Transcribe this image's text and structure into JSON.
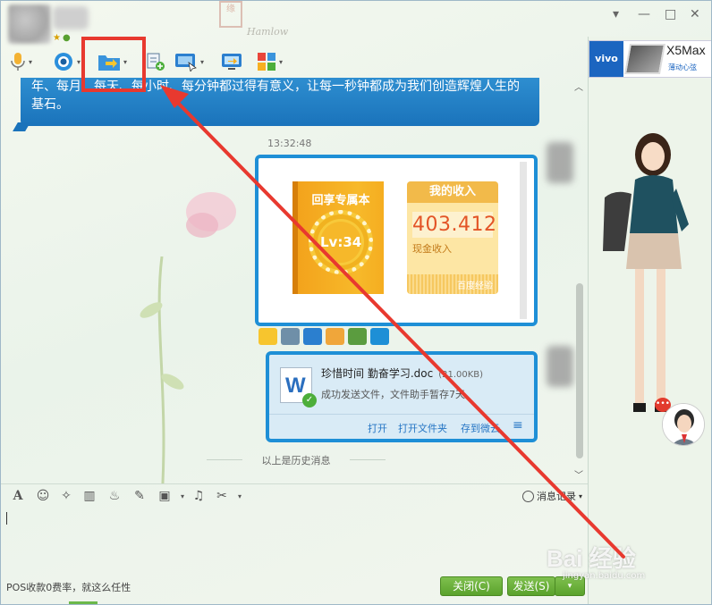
{
  "titlebar": {
    "seal_text": "缘",
    "signature_text": "Hamlow",
    "controls": {
      "menu": "▾",
      "minimize": "—",
      "maximize": "□",
      "close": "✕"
    }
  },
  "toolbar": {
    "items": [
      {
        "name": "microphone-icon"
      },
      {
        "name": "camera-icon"
      },
      {
        "name": "send-file-icon"
      },
      {
        "name": "add-contact-icon"
      },
      {
        "name": "remote-assist-icon"
      },
      {
        "name": "screen-share-icon"
      },
      {
        "name": "apps-grid-icon"
      }
    ]
  },
  "chat": {
    "banner_message": "年、每月、每天、每小时、每分钟都过得有意义，让每一秒钟都成为我们创造辉煌人生的基石。",
    "timestamp": "13:32:48",
    "card": {
      "book_title": "回享专属本",
      "level": "Lv:34",
      "income_title": "我的收入",
      "income_value": "403.412",
      "income_label": "现金收入",
      "income_footer": "百度经验"
    },
    "file": {
      "name": "珍惜时间 勤奋学习.doc",
      "size": "(21.00KB)",
      "status": "成功发送文件，文件助手暂存7天",
      "actions": {
        "open": "打开",
        "open_folder": "打开文件夹",
        "save_to_cloud": "存到微云"
      }
    },
    "history_divider": "以上是历史消息"
  },
  "input_toolbar": {
    "message_history_label": "消息记录"
  },
  "bottombar": {
    "ad_text": "POS收款0费率，就这么任性",
    "close_label": "关闭(C)",
    "send_label": "发送(S)"
  },
  "right_panel": {
    "brand": "vivo",
    "model": "X5Max",
    "slogan": "薄动心弦",
    "notification_dots": "•••"
  },
  "watermark": {
    "main": "Bai 经验",
    "sub": "jingyan.baidu.com"
  },
  "colors": {
    "accent_blue": "#1e8fd6",
    "highlight_red": "#e8392f",
    "send_green": "#5aa22c"
  }
}
